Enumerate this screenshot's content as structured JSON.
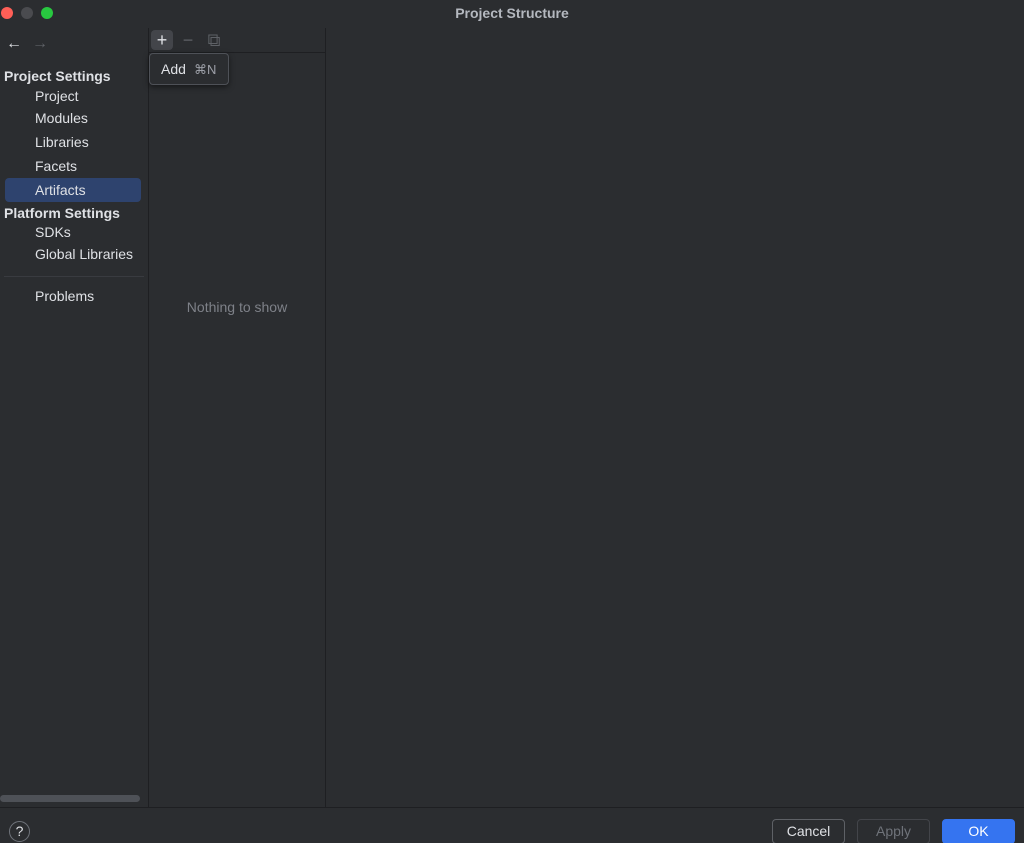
{
  "window": {
    "title": "Project Structure"
  },
  "nav": {
    "back_icon": "←",
    "forward_icon": "→"
  },
  "sidebar": {
    "project_settings_header": "Project Settings",
    "project_items": [
      {
        "label": "Project"
      },
      {
        "label": "Modules"
      },
      {
        "label": "Libraries"
      },
      {
        "label": "Facets"
      },
      {
        "label": "Artifacts",
        "selected": true
      }
    ],
    "platform_settings_header": "Platform Settings",
    "platform_items": [
      {
        "label": "SDKs"
      },
      {
        "label": "Global Libraries"
      }
    ],
    "problems_label": "Problems"
  },
  "toolbar": {
    "add_icon": "+",
    "remove_icon": "−",
    "copy_icon": "⧉"
  },
  "tooltip": {
    "label": "Add",
    "shortcut": "⌘N"
  },
  "list": {
    "empty_text": "Nothing to show"
  },
  "footer": {
    "help_icon": "?",
    "cancel_label": "Cancel",
    "apply_label": "Apply",
    "ok_label": "OK"
  },
  "colors": {
    "background": "#2b2d30",
    "selection": "#2e436e",
    "accent": "#3574f0",
    "close": "#ff5f57",
    "maximize": "#28c840"
  }
}
